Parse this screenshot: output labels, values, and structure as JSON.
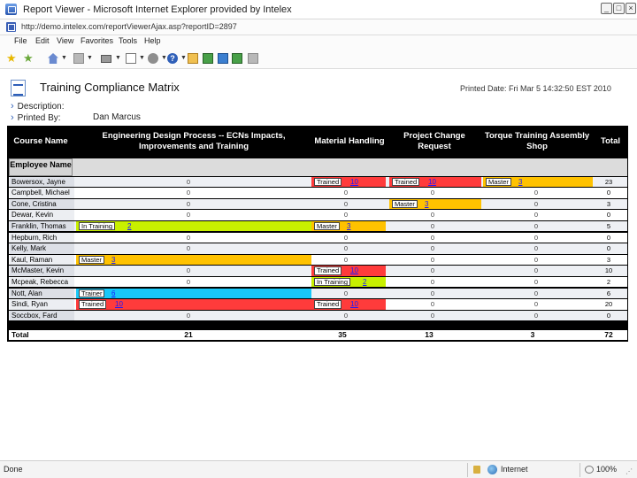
{
  "window": {
    "title": "Report Viewer - Microsoft Internet Explorer provided by Intelex",
    "min_label": "_",
    "max_label": "□",
    "close_label": "×"
  },
  "address": {
    "url": "http://demo.intelex.com/reportViewerAjax.asp?reportID=2897"
  },
  "menu": [
    "File",
    "Edit",
    "View",
    "Favorites",
    "Tools",
    "Help"
  ],
  "toolbar_icons": [
    "favorites-star-icon",
    "add-favorites-icon",
    "home-icon",
    "feeds-icon",
    "print-icon",
    "page-icon",
    "tools-icon",
    "help-icon",
    "mail-icon",
    "excel-icon",
    "messenger-icon",
    "research-icon"
  ],
  "report": {
    "title": "Training Compliance Matrix",
    "printed_date": "Printed Date: Fri Mar 5 14:32:50 EST 2010",
    "description_label": "Description:",
    "description_value": "",
    "printed_by_label": "Printed By:",
    "printed_by_value": "Dan Marcus"
  },
  "matrix": {
    "headers": {
      "course": "Course Name",
      "c1": "Engineering Design Process -- ECNs Impacts, Improvements and Training",
      "c2": "Material Handling",
      "c3": "Project Change Request",
      "c4": "Torque Training Assembly Shop",
      "total": "Total"
    },
    "employee_header": "Employee Name",
    "status_colors": {
      "Trained": "#ff3b3b",
      "Master": "#ffc200",
      "In Training": "#c8f000",
      "Trainer": "#18c8f8"
    },
    "rows": [
      {
        "name": "Bowersox, Jayne",
        "cells": [
          null,
          {
            "status": "Trained",
            "count": "10"
          },
          {
            "status": "Trained",
            "count": "10"
          },
          {
            "status": "Master",
            "count": "3"
          }
        ],
        "zeros": [
          "0",
          "",
          "",
          ""
        ],
        "total": "23"
      },
      {
        "name": "Campbell, Michael",
        "cells": [
          null,
          null,
          null,
          null
        ],
        "zeros": [
          "0",
          "0",
          "0",
          "0"
        ],
        "total": "0"
      },
      {
        "name": "Cone, Cristina",
        "cells": [
          null,
          null,
          {
            "status": "Master",
            "count": "3"
          },
          null
        ],
        "zeros": [
          "0",
          "0",
          "",
          "0"
        ],
        "total": "3"
      },
      {
        "name": "Dewar, Kevin",
        "cells": [
          null,
          null,
          null,
          null
        ],
        "zeros": [
          "0",
          "0",
          "0",
          "0"
        ],
        "total": "0"
      },
      {
        "name": "Franklin, Thomas",
        "cells": [
          {
            "status": "In Training",
            "count": "2"
          },
          {
            "status": "Master",
            "count": "3"
          },
          null,
          null
        ],
        "zeros": [
          "",
          "",
          "0",
          "0"
        ],
        "total": "5"
      },
      {
        "name": "Hepburn, Rich",
        "cells": [
          null,
          null,
          null,
          null
        ],
        "zeros": [
          "0",
          "0",
          "0",
          "0"
        ],
        "total": "0"
      },
      {
        "name": "Kelly, Mark",
        "cells": [
          null,
          null,
          null,
          null
        ],
        "zeros": [
          "0",
          "0",
          "0",
          "0"
        ],
        "total": "0"
      },
      {
        "name": "Kaul, Raman",
        "cells": [
          {
            "status": "Master",
            "count": "3"
          },
          null,
          null,
          null
        ],
        "zeros": [
          "",
          "0",
          "0",
          "0"
        ],
        "total": "3"
      },
      {
        "name": "McMaster, Kevin",
        "cells": [
          null,
          {
            "status": "Trained",
            "count": "10"
          },
          null,
          null
        ],
        "zeros": [
          "0",
          "",
          "0",
          "0"
        ],
        "total": "10"
      },
      {
        "name": "Mcpeak, Rebecca",
        "cells": [
          null,
          {
            "status": "In Training",
            "count": "2"
          },
          null,
          null
        ],
        "zeros": [
          "0",
          "",
          "0",
          "0"
        ],
        "total": "2"
      },
      {
        "name": "Nott, Alan",
        "cells": [
          {
            "status": "Trainer",
            "count": "6"
          },
          null,
          null,
          null
        ],
        "zeros": [
          "",
          "0",
          "0",
          "0"
        ],
        "total": "6"
      },
      {
        "name": "Sindi, Ryan",
        "cells": [
          {
            "status": "Trained",
            "count": "10"
          },
          {
            "status": "Trained",
            "count": "10"
          },
          null,
          null
        ],
        "zeros": [
          "",
          "",
          "0",
          "0"
        ],
        "total": "20"
      },
      {
        "name": "Soccbox, Fard",
        "cells": [
          null,
          null,
          null,
          null
        ],
        "zeros": [
          "0",
          "0",
          "0",
          "0"
        ],
        "total": "0"
      }
    ],
    "totals": {
      "label": "Total",
      "c1": "21",
      "c2": "35",
      "c3": "13",
      "c4": "3",
      "total": "72"
    }
  },
  "statusbar": {
    "text": "Done",
    "zone": "Internet",
    "zoom": "100%"
  }
}
